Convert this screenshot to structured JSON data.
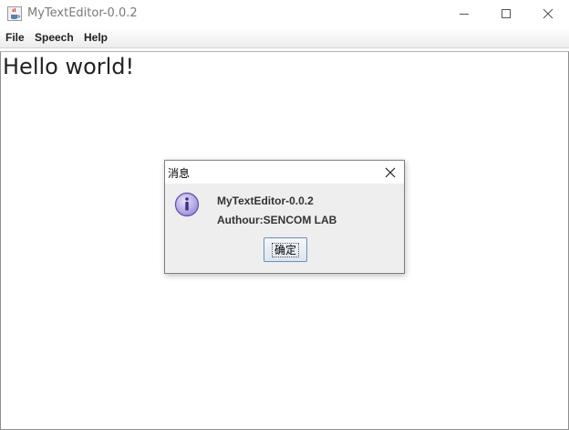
{
  "window": {
    "title": "MyTextEditor-0.0.2",
    "icon": "java-cup-icon"
  },
  "menubar": {
    "items": [
      {
        "label": "File"
      },
      {
        "label": "Speech"
      },
      {
        "label": "Help"
      }
    ]
  },
  "editor": {
    "text": "Hello world!"
  },
  "dialog": {
    "title": "消息",
    "icon": "info-icon",
    "line1": "MyTextEditor-0.0.2",
    "line2": "Authour:SENCOM LAB",
    "ok_label": "确定"
  },
  "colors": {
    "dialog_bg": "#eeeeee",
    "info_icon_fill": "#b7a8e8",
    "button_border": "#6b8fb8"
  }
}
